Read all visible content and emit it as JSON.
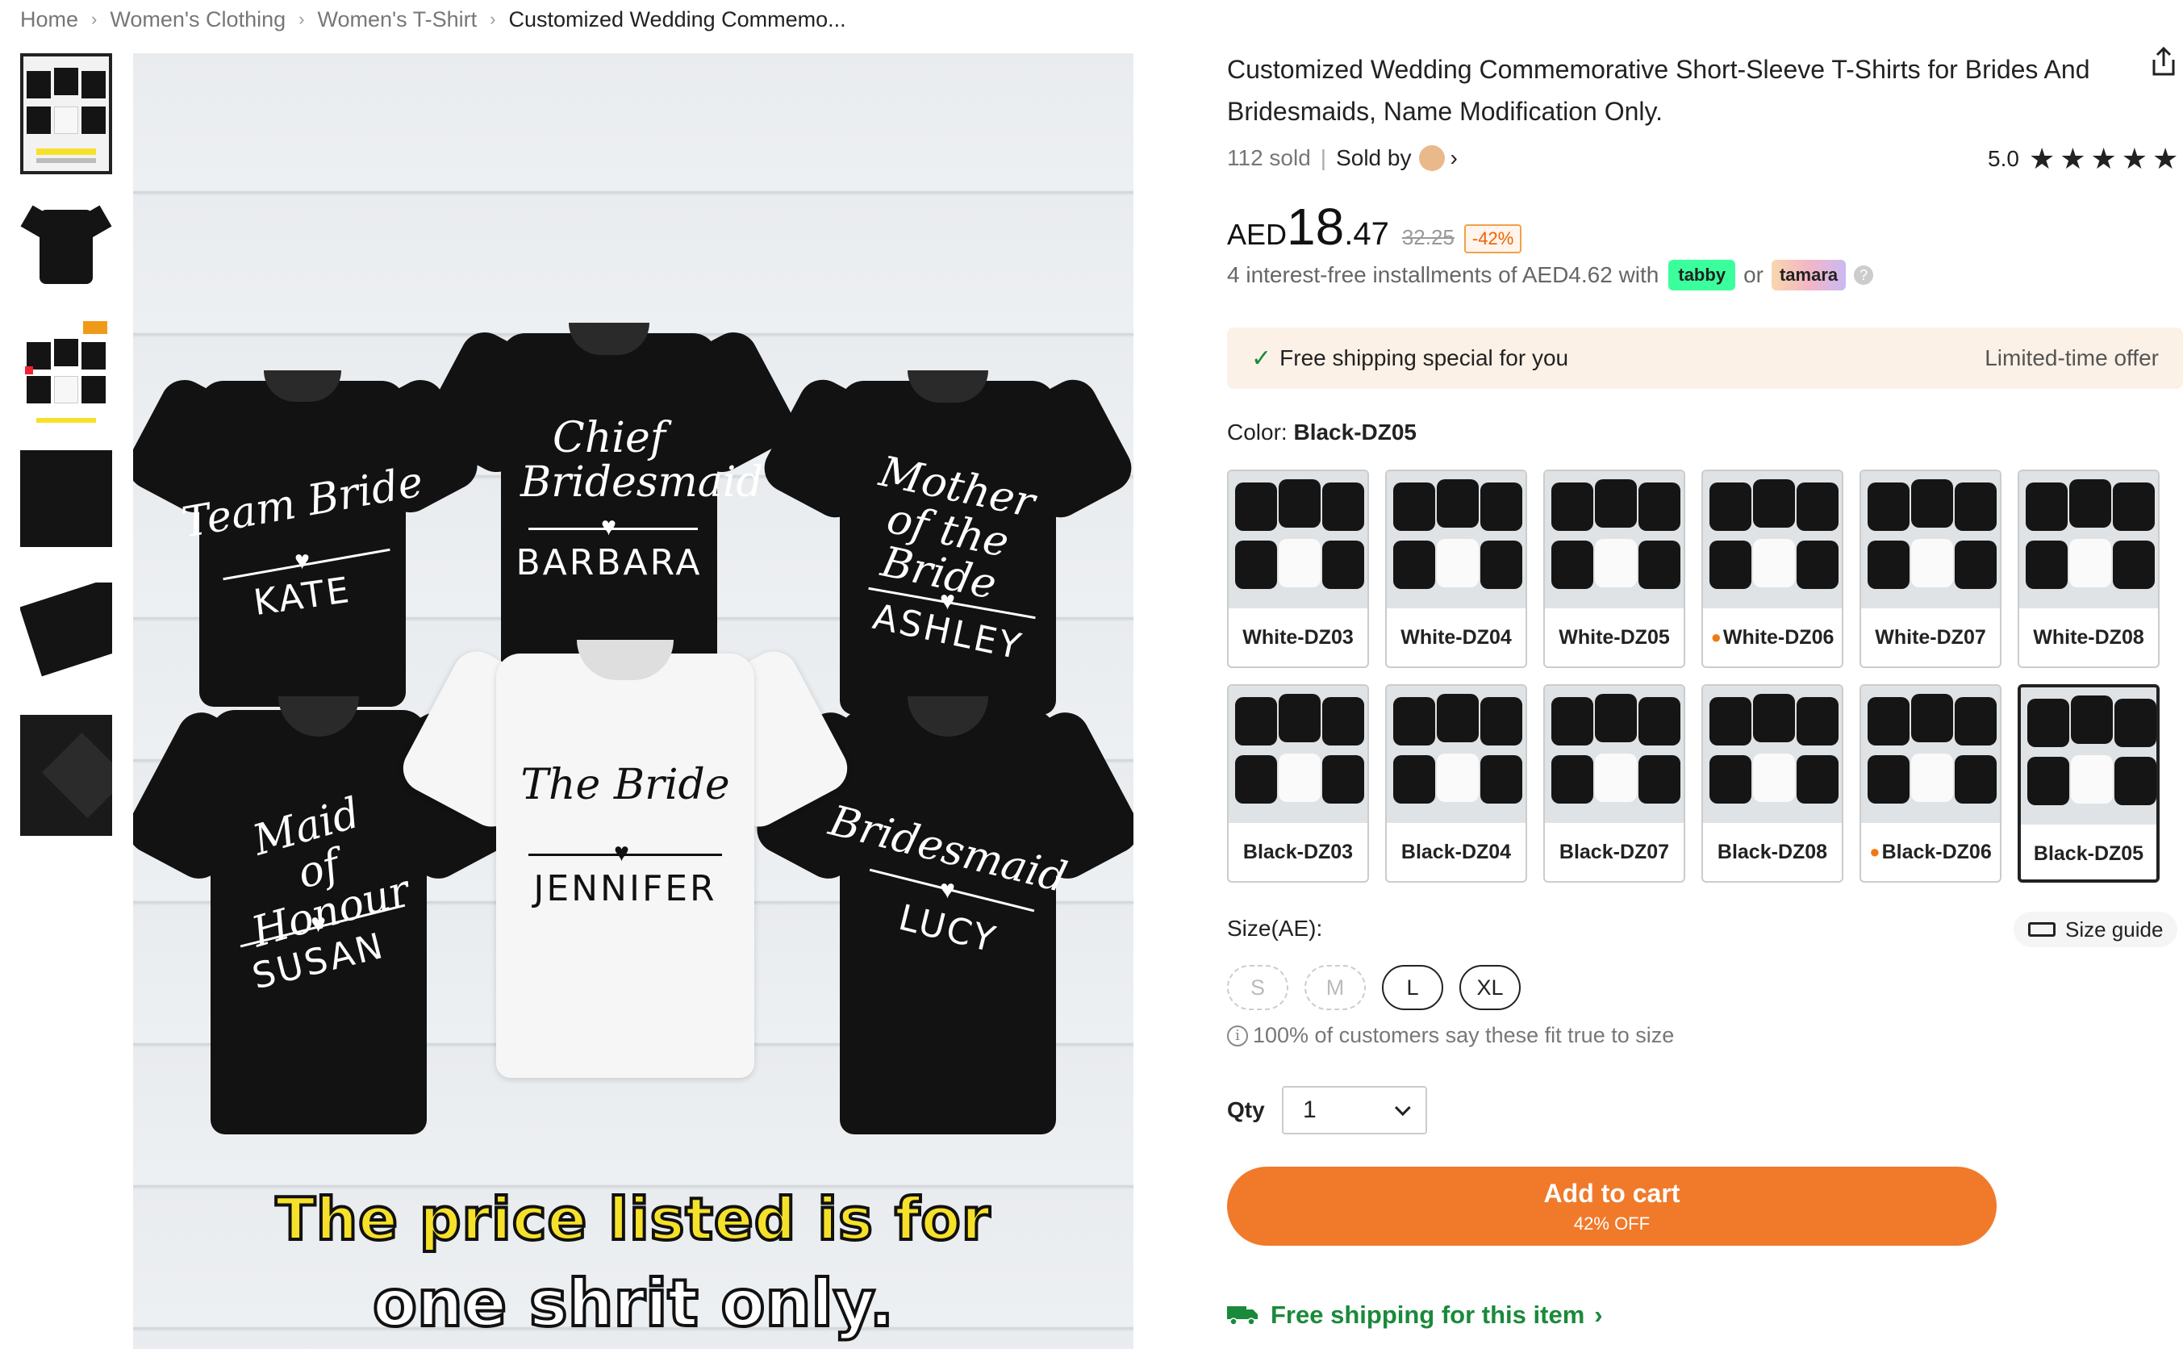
{
  "breadcrumb": [
    "Home",
    "Women's Clothing",
    "Women's T-Shirt",
    "Customized Wedding Commemo..."
  ],
  "breadcrumb_sep": "›",
  "main_image": {
    "shirts": [
      {
        "script": "Team Bride",
        "name": "KATE"
      },
      {
        "script": "Chief Bridesmaid",
        "name": "BARBARA"
      },
      {
        "script": "Mother of the Bride",
        "name": "ASHLEY"
      },
      {
        "script": "Maid of Honour",
        "name": "SUSAN"
      },
      {
        "script": "The Bride",
        "name": "JENNIFER"
      },
      {
        "script": "Bridesmaid",
        "name": "LUCY"
      }
    ],
    "caption_line1": "The price listed is for",
    "caption_line2": "one shrit only."
  },
  "product": {
    "title": "Customized Wedding Commemorative Short-Sleeve T-Shirts for Brides And Bridesmaids, Name Modification Only.",
    "sold": "112 sold",
    "sold_by": "Sold by",
    "rating": "5.0",
    "stars": "★★★★★",
    "price_currency": "AED",
    "price_int": "18",
    "price_dec": ".47",
    "price_old": "32.25",
    "discount": "-42%",
    "installments": "4 interest-free installments of AED4.62 with",
    "tabby": "tabby",
    "or": "or",
    "tamara": "tamara",
    "help": "?"
  },
  "shipping_banner": {
    "text": "Free shipping special for you",
    "offer": "Limited-time offer",
    "check": "✓"
  },
  "color": {
    "label": "Color:",
    "selected": "Black-DZ05",
    "options": [
      {
        "label": "White-DZ03",
        "hot": false
      },
      {
        "label": "White-DZ04",
        "hot": false
      },
      {
        "label": "White-DZ05",
        "hot": false
      },
      {
        "label": "White-DZ06",
        "hot": true
      },
      {
        "label": "White-DZ07",
        "hot": false
      },
      {
        "label": "White-DZ08",
        "hot": false
      },
      {
        "label": "Black-DZ03",
        "hot": false
      },
      {
        "label": "Black-DZ04",
        "hot": false
      },
      {
        "label": "Black-DZ07",
        "hot": false
      },
      {
        "label": "Black-DZ08",
        "hot": false
      },
      {
        "label": "Black-DZ06",
        "hot": true
      },
      {
        "label": "Black-DZ05",
        "hot": false,
        "selected": true
      }
    ]
  },
  "size": {
    "label": "Size(AE):",
    "guide": "Size guide",
    "options": [
      {
        "label": "S",
        "available": false
      },
      {
        "label": "M",
        "available": false
      },
      {
        "label": "L",
        "available": true
      },
      {
        "label": "XL",
        "available": true
      }
    ],
    "fit_note": "100% of customers say these fit true to size",
    "info": "i"
  },
  "qty": {
    "label": "Qty",
    "value": "1"
  },
  "cart": {
    "label": "Add to cart",
    "sub": "42% OFF"
  },
  "free_shipping_link": "Free shipping for this item",
  "chevron": "›",
  "colors": {
    "accent": "#f07a2a",
    "green": "#1a8a3a",
    "banner": "#fbf1e6"
  }
}
